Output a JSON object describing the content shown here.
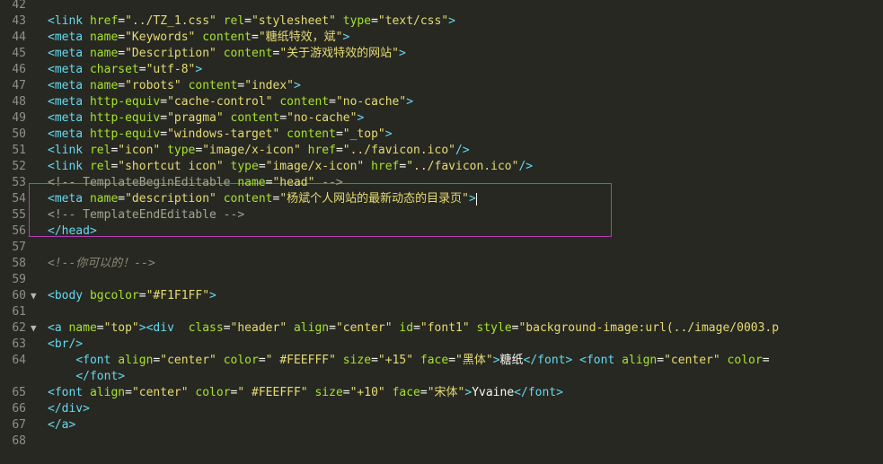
{
  "editor": {
    "lines": [
      {
        "n": "42",
        "fold": "",
        "tokens": []
      },
      {
        "n": "43",
        "fold": "",
        "tokens": [
          {
            "c": "t",
            "v": "<link "
          },
          {
            "c": "a",
            "v": "href"
          },
          {
            "c": "p",
            "v": "="
          },
          {
            "c": "s",
            "v": "\"../TZ_1.css\""
          },
          {
            "c": "p",
            "v": " "
          },
          {
            "c": "a",
            "v": "rel"
          },
          {
            "c": "p",
            "v": "="
          },
          {
            "c": "s",
            "v": "\"stylesheet\""
          },
          {
            "c": "p",
            "v": " "
          },
          {
            "c": "a",
            "v": "type"
          },
          {
            "c": "p",
            "v": "="
          },
          {
            "c": "s",
            "v": "\"text/css\""
          },
          {
            "c": "t",
            "v": ">"
          }
        ]
      },
      {
        "n": "44",
        "fold": "",
        "tokens": [
          {
            "c": "t",
            "v": "<meta "
          },
          {
            "c": "a",
            "v": "name"
          },
          {
            "c": "p",
            "v": "="
          },
          {
            "c": "s",
            "v": "\"Keywords\""
          },
          {
            "c": "p",
            "v": " "
          },
          {
            "c": "a",
            "v": "content"
          },
          {
            "c": "p",
            "v": "="
          },
          {
            "c": "s",
            "v": "\"糖纸特效，斌\""
          },
          {
            "c": "t",
            "v": ">"
          }
        ]
      },
      {
        "n": "45",
        "fold": "",
        "tokens": [
          {
            "c": "t",
            "v": "<meta "
          },
          {
            "c": "a",
            "v": "name"
          },
          {
            "c": "p",
            "v": "="
          },
          {
            "c": "s",
            "v": "\"Description\""
          },
          {
            "c": "p",
            "v": " "
          },
          {
            "c": "a",
            "v": "content"
          },
          {
            "c": "p",
            "v": "="
          },
          {
            "c": "s",
            "v": "\"关于游戏特效的网站\""
          },
          {
            "c": "t",
            "v": ">"
          }
        ]
      },
      {
        "n": "46",
        "fold": "",
        "tokens": [
          {
            "c": "t",
            "v": "<meta "
          },
          {
            "c": "a",
            "v": "charset"
          },
          {
            "c": "p",
            "v": "="
          },
          {
            "c": "s",
            "v": "\"utf-8\""
          },
          {
            "c": "t",
            "v": ">"
          }
        ]
      },
      {
        "n": "47",
        "fold": "",
        "tokens": [
          {
            "c": "t",
            "v": "<meta "
          },
          {
            "c": "a",
            "v": "name"
          },
          {
            "c": "p",
            "v": "="
          },
          {
            "c": "s",
            "v": "\"robots\""
          },
          {
            "c": "p",
            "v": " "
          },
          {
            "c": "a",
            "v": "content"
          },
          {
            "c": "p",
            "v": "="
          },
          {
            "c": "s",
            "v": "\"index\""
          },
          {
            "c": "t",
            "v": ">"
          }
        ]
      },
      {
        "n": "48",
        "fold": "",
        "tokens": [
          {
            "c": "t",
            "v": "<meta "
          },
          {
            "c": "a",
            "v": "http-equiv"
          },
          {
            "c": "p",
            "v": "="
          },
          {
            "c": "s",
            "v": "\"cache-control\""
          },
          {
            "c": "p",
            "v": " "
          },
          {
            "c": "a",
            "v": "content"
          },
          {
            "c": "p",
            "v": "="
          },
          {
            "c": "s",
            "v": "\"no-cache\""
          },
          {
            "c": "t",
            "v": ">"
          }
        ]
      },
      {
        "n": "49",
        "fold": "",
        "tokens": [
          {
            "c": "t",
            "v": "<meta "
          },
          {
            "c": "a",
            "v": "http-equiv"
          },
          {
            "c": "p",
            "v": "="
          },
          {
            "c": "s",
            "v": "\"pragma\""
          },
          {
            "c": "p",
            "v": " "
          },
          {
            "c": "a",
            "v": "content"
          },
          {
            "c": "p",
            "v": "="
          },
          {
            "c": "s",
            "v": "\"no-cache\""
          },
          {
            "c": "t",
            "v": ">"
          }
        ]
      },
      {
        "n": "50",
        "fold": "",
        "tokens": [
          {
            "c": "t",
            "v": "<meta "
          },
          {
            "c": "a",
            "v": "http-equiv"
          },
          {
            "c": "p",
            "v": "="
          },
          {
            "c": "s",
            "v": "\"windows-target\""
          },
          {
            "c": "p",
            "v": " "
          },
          {
            "c": "a",
            "v": "content"
          },
          {
            "c": "p",
            "v": "="
          },
          {
            "c": "s",
            "v": "\"_top\""
          },
          {
            "c": "t",
            "v": ">"
          }
        ]
      },
      {
        "n": "51",
        "fold": "",
        "tokens": [
          {
            "c": "t",
            "v": "<link "
          },
          {
            "c": "a",
            "v": "rel"
          },
          {
            "c": "p",
            "v": "="
          },
          {
            "c": "s",
            "v": "\"icon\""
          },
          {
            "c": "p",
            "v": " "
          },
          {
            "c": "a",
            "v": "type"
          },
          {
            "c": "p",
            "v": "="
          },
          {
            "c": "s",
            "v": "\"image/x-icon\""
          },
          {
            "c": "p",
            "v": " "
          },
          {
            "c": "a",
            "v": "href"
          },
          {
            "c": "p",
            "v": "="
          },
          {
            "c": "s",
            "v": "\"../favicon.ico\""
          },
          {
            "c": "t",
            "v": "/>"
          }
        ]
      },
      {
        "n": "52",
        "fold": "",
        "tokens": [
          {
            "c": "t",
            "v": "<link "
          },
          {
            "c": "a",
            "v": "rel"
          },
          {
            "c": "p",
            "v": "="
          },
          {
            "c": "s",
            "v": "\"shortcut icon\""
          },
          {
            "c": "p",
            "v": " "
          },
          {
            "c": "a",
            "v": "type"
          },
          {
            "c": "p",
            "v": "="
          },
          {
            "c": "s",
            "v": "\"image/x-icon\""
          },
          {
            "c": "p",
            "v": " "
          },
          {
            "c": "a",
            "v": "href"
          },
          {
            "c": "p",
            "v": "="
          },
          {
            "c": "s",
            "v": "\"../favicon.ico\""
          },
          {
            "c": "t",
            "v": "/>"
          }
        ]
      },
      {
        "n": "53",
        "fold": "",
        "tokens": [
          {
            "c": "c",
            "v": "<!-- TemplateBeginEditable "
          },
          {
            "c": "a",
            "v": "name"
          },
          {
            "c": "p",
            "v": "="
          },
          {
            "c": "s",
            "v": "\"head\""
          },
          {
            "c": "c",
            "v": " -->"
          }
        ]
      },
      {
        "n": "54",
        "fold": "",
        "caret": true,
        "tokens": [
          {
            "c": "t",
            "v": "<meta "
          },
          {
            "c": "a",
            "v": "name"
          },
          {
            "c": "p",
            "v": "="
          },
          {
            "c": "s",
            "v": "\"description\""
          },
          {
            "c": "p",
            "v": " "
          },
          {
            "c": "a",
            "v": "content"
          },
          {
            "c": "p",
            "v": "="
          },
          {
            "c": "s",
            "v": "\"杨斌个人网站的最新动态的目录页\""
          },
          {
            "c": "t",
            "v": ">"
          }
        ]
      },
      {
        "n": "55",
        "fold": "",
        "tokens": [
          {
            "c": "c",
            "v": "<!-- TemplateEndEditable -->"
          }
        ]
      },
      {
        "n": "56",
        "fold": "",
        "tokens": [
          {
            "c": "t",
            "v": "</head>"
          }
        ]
      },
      {
        "n": "57",
        "fold": "",
        "tokens": []
      },
      {
        "n": "58",
        "fold": "",
        "tokens": [
          {
            "c": "ci",
            "v": "<!--你可以的！-->"
          }
        ]
      },
      {
        "n": "59",
        "fold": "",
        "tokens": []
      },
      {
        "n": "60",
        "fold": "▼",
        "tokens": [
          {
            "c": "t",
            "v": "<body "
          },
          {
            "c": "a",
            "v": "bgcolor"
          },
          {
            "c": "p",
            "v": "="
          },
          {
            "c": "s",
            "v": "\"#F1F1FF\""
          },
          {
            "c": "t",
            "v": ">"
          }
        ]
      },
      {
        "n": "61",
        "fold": "",
        "tokens": []
      },
      {
        "n": "62",
        "fold": "▼",
        "tokens": [
          {
            "c": "t",
            "v": "<a "
          },
          {
            "c": "a",
            "v": "name"
          },
          {
            "c": "p",
            "v": "="
          },
          {
            "c": "s",
            "v": "\"top\""
          },
          {
            "c": "t",
            "v": "><div "
          },
          {
            "c": "p",
            "v": " "
          },
          {
            "c": "a",
            "v": "class"
          },
          {
            "c": "p",
            "v": "="
          },
          {
            "c": "s",
            "v": "\"header\""
          },
          {
            "c": "p",
            "v": " "
          },
          {
            "c": "a",
            "v": "align"
          },
          {
            "c": "p",
            "v": "="
          },
          {
            "c": "s",
            "v": "\"center\""
          },
          {
            "c": "p",
            "v": " "
          },
          {
            "c": "a",
            "v": "id"
          },
          {
            "c": "p",
            "v": "="
          },
          {
            "c": "s",
            "v": "\"font1\""
          },
          {
            "c": "p",
            "v": " "
          },
          {
            "c": "a",
            "v": "style"
          },
          {
            "c": "p",
            "v": "="
          },
          {
            "c": "s",
            "v": "\"background-image:url(../image/0003.p"
          }
        ]
      },
      {
        "n": "63",
        "fold": "",
        "tokens": [
          {
            "c": "t",
            "v": "<br/>"
          }
        ]
      },
      {
        "n": "64",
        "fold": "",
        "tokens": [
          {
            "c": "p",
            "v": "    "
          },
          {
            "c": "t",
            "v": "<font "
          },
          {
            "c": "a",
            "v": "align"
          },
          {
            "c": "p",
            "v": "="
          },
          {
            "c": "s",
            "v": "\"center\""
          },
          {
            "c": "p",
            "v": " "
          },
          {
            "c": "a",
            "v": "color"
          },
          {
            "c": "p",
            "v": "="
          },
          {
            "c": "s",
            "v": "\" #FEEFFF\""
          },
          {
            "c": "p",
            "v": " "
          },
          {
            "c": "a",
            "v": "size"
          },
          {
            "c": "p",
            "v": "="
          },
          {
            "c": "s",
            "v": "\"+15\""
          },
          {
            "c": "p",
            "v": " "
          },
          {
            "c": "a",
            "v": "face"
          },
          {
            "c": "p",
            "v": "="
          },
          {
            "c": "s",
            "v": "\"黑体\""
          },
          {
            "c": "t",
            "v": ">"
          },
          {
            "c": "p",
            "v": "糖纸"
          },
          {
            "c": "t",
            "v": "</font>"
          },
          {
            "c": "p",
            "v": " "
          },
          {
            "c": "t",
            "v": "<font "
          },
          {
            "c": "a",
            "v": "align"
          },
          {
            "c": "p",
            "v": "="
          },
          {
            "c": "s",
            "v": "\"center\""
          },
          {
            "c": "p",
            "v": " "
          },
          {
            "c": "a",
            "v": "color"
          },
          {
            "c": "p",
            "v": "="
          }
        ]
      },
      {
        "n": "",
        "fold": "",
        "tokens": [
          {
            "c": "p",
            "v": "    "
          },
          {
            "c": "t",
            "v": "</font>"
          }
        ]
      },
      {
        "n": "65",
        "fold": "",
        "tokens": [
          {
            "c": "t",
            "v": "<font "
          },
          {
            "c": "a",
            "v": "align"
          },
          {
            "c": "p",
            "v": "="
          },
          {
            "c": "s",
            "v": "\"center\""
          },
          {
            "c": "p",
            "v": " "
          },
          {
            "c": "a",
            "v": "color"
          },
          {
            "c": "p",
            "v": "="
          },
          {
            "c": "s",
            "v": "\" #FEEFFF\""
          },
          {
            "c": "p",
            "v": " "
          },
          {
            "c": "a",
            "v": "size"
          },
          {
            "c": "p",
            "v": "="
          },
          {
            "c": "s",
            "v": "\"+10\""
          },
          {
            "c": "p",
            "v": " "
          },
          {
            "c": "a",
            "v": "face"
          },
          {
            "c": "p",
            "v": "="
          },
          {
            "c": "s",
            "v": "\"宋体\""
          },
          {
            "c": "t",
            "v": ">"
          },
          {
            "c": "p",
            "v": "Yvaine"
          },
          {
            "c": "t",
            "v": "</font>"
          }
        ]
      },
      {
        "n": "66",
        "fold": "",
        "tokens": [
          {
            "c": "t",
            "v": "</div>"
          }
        ]
      },
      {
        "n": "67",
        "fold": "",
        "tokens": [
          {
            "c": "t",
            "v": "</a>"
          }
        ]
      },
      {
        "n": "68",
        "fold": "",
        "tokens": []
      }
    ]
  }
}
